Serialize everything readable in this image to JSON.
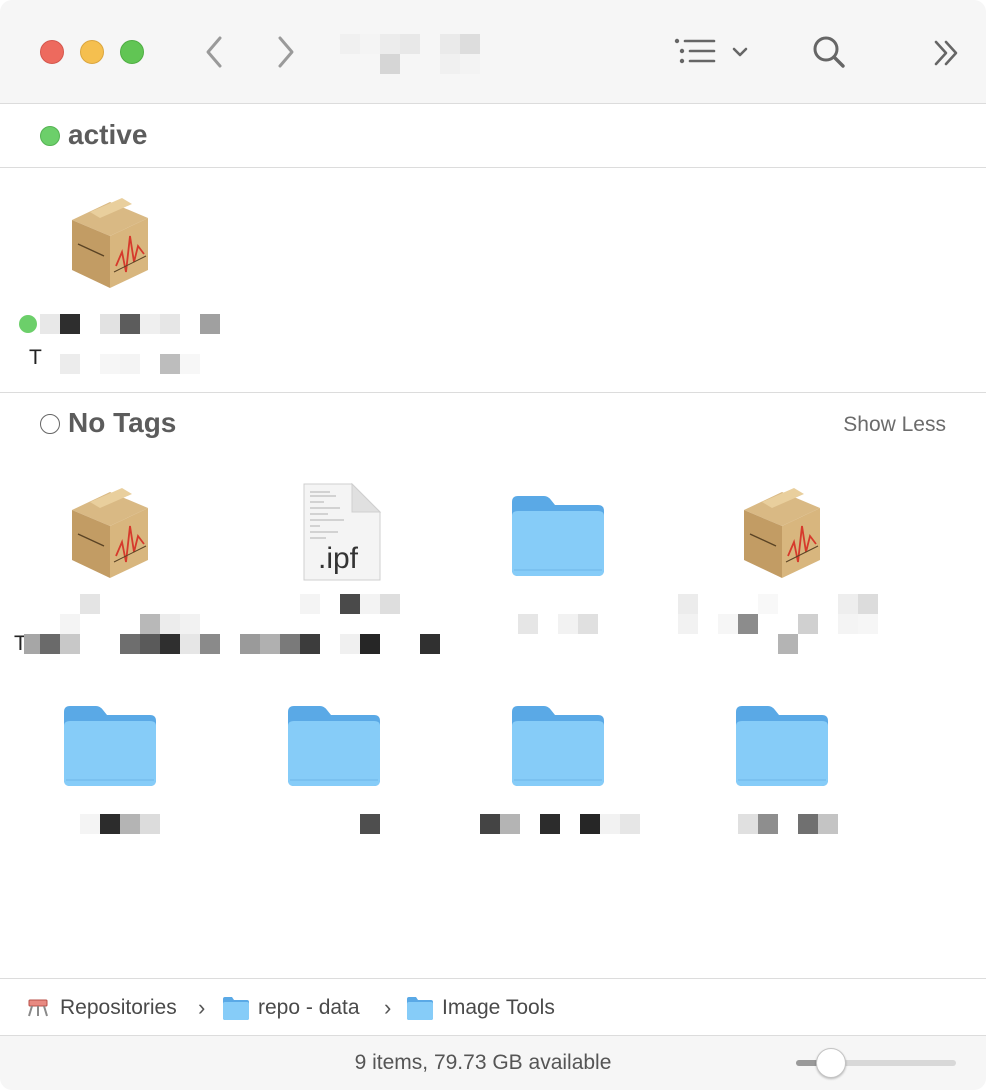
{
  "toolbar": {
    "back_icon": "chevron-left-icon",
    "forward_icon": "chevron-right-icon",
    "view_options_icon": "list-view-icon",
    "search_icon": "magnifier-icon",
    "more_icon": "double-chevron-right-icon"
  },
  "sections": {
    "active": {
      "title": "active",
      "tag_color": "#6ccf6a",
      "items": [
        {
          "icon": "installer-package-icon",
          "tag_color": "#6ccf6a",
          "name_prefix": "T"
        }
      ]
    },
    "no_tags": {
      "title": "No Tags",
      "action": "Show Less",
      "row1": [
        {
          "icon": "installer-package-icon",
          "name_prefix": "T"
        },
        {
          "icon": "document-icon",
          "extension": ".ipf"
        },
        {
          "icon": "folder-icon"
        },
        {
          "icon": "installer-package-icon"
        }
      ],
      "row2": [
        {
          "icon": "folder-icon"
        },
        {
          "icon": "folder-icon"
        },
        {
          "icon": "folder-icon"
        },
        {
          "icon": "folder-icon"
        }
      ]
    }
  },
  "pathbar": {
    "items": [
      {
        "icon": "hard-drive-icon",
        "label": "Repositories"
      },
      {
        "icon": "folder-icon",
        "label": "repo - data"
      },
      {
        "icon": "folder-icon",
        "label": "Image Tools"
      }
    ]
  },
  "status": {
    "text": "9 items, 79.73 GB available",
    "zoom_level": 0.22
  },
  "colors": {
    "folder_front": "#86ccf8",
    "folder_back": "#5aa9e6",
    "green_tag": "#6ccf6a"
  }
}
